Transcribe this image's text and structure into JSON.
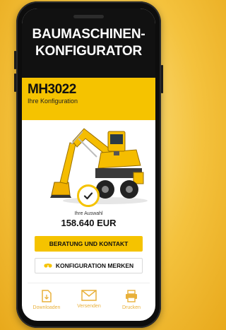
{
  "promo": {
    "title": "BAUMASCHINEN-\nKONFIGURATOR"
  },
  "product": {
    "model": "MH3022",
    "config_label": "Ihre Konfiguration"
  },
  "selection": {
    "label": "Ihre Auswahl",
    "price": "158.640 EUR"
  },
  "buttons": {
    "contact": "BERATUNG UND KONTAKT",
    "save": "KONFIGURATION MERKEN",
    "save_icon": "binoculars-icon"
  },
  "actions": [
    {
      "label": "Downloaden",
      "icon": "document-download-icon"
    },
    {
      "label": "Versenden",
      "icon": "envelope-icon"
    },
    {
      "label": "Drucken",
      "icon": "printer-icon"
    }
  ],
  "colors": {
    "accent": "#f5c300",
    "action_text": "#e8b03a",
    "background": "#f4c23d",
    "header_bg": "#111111"
  }
}
